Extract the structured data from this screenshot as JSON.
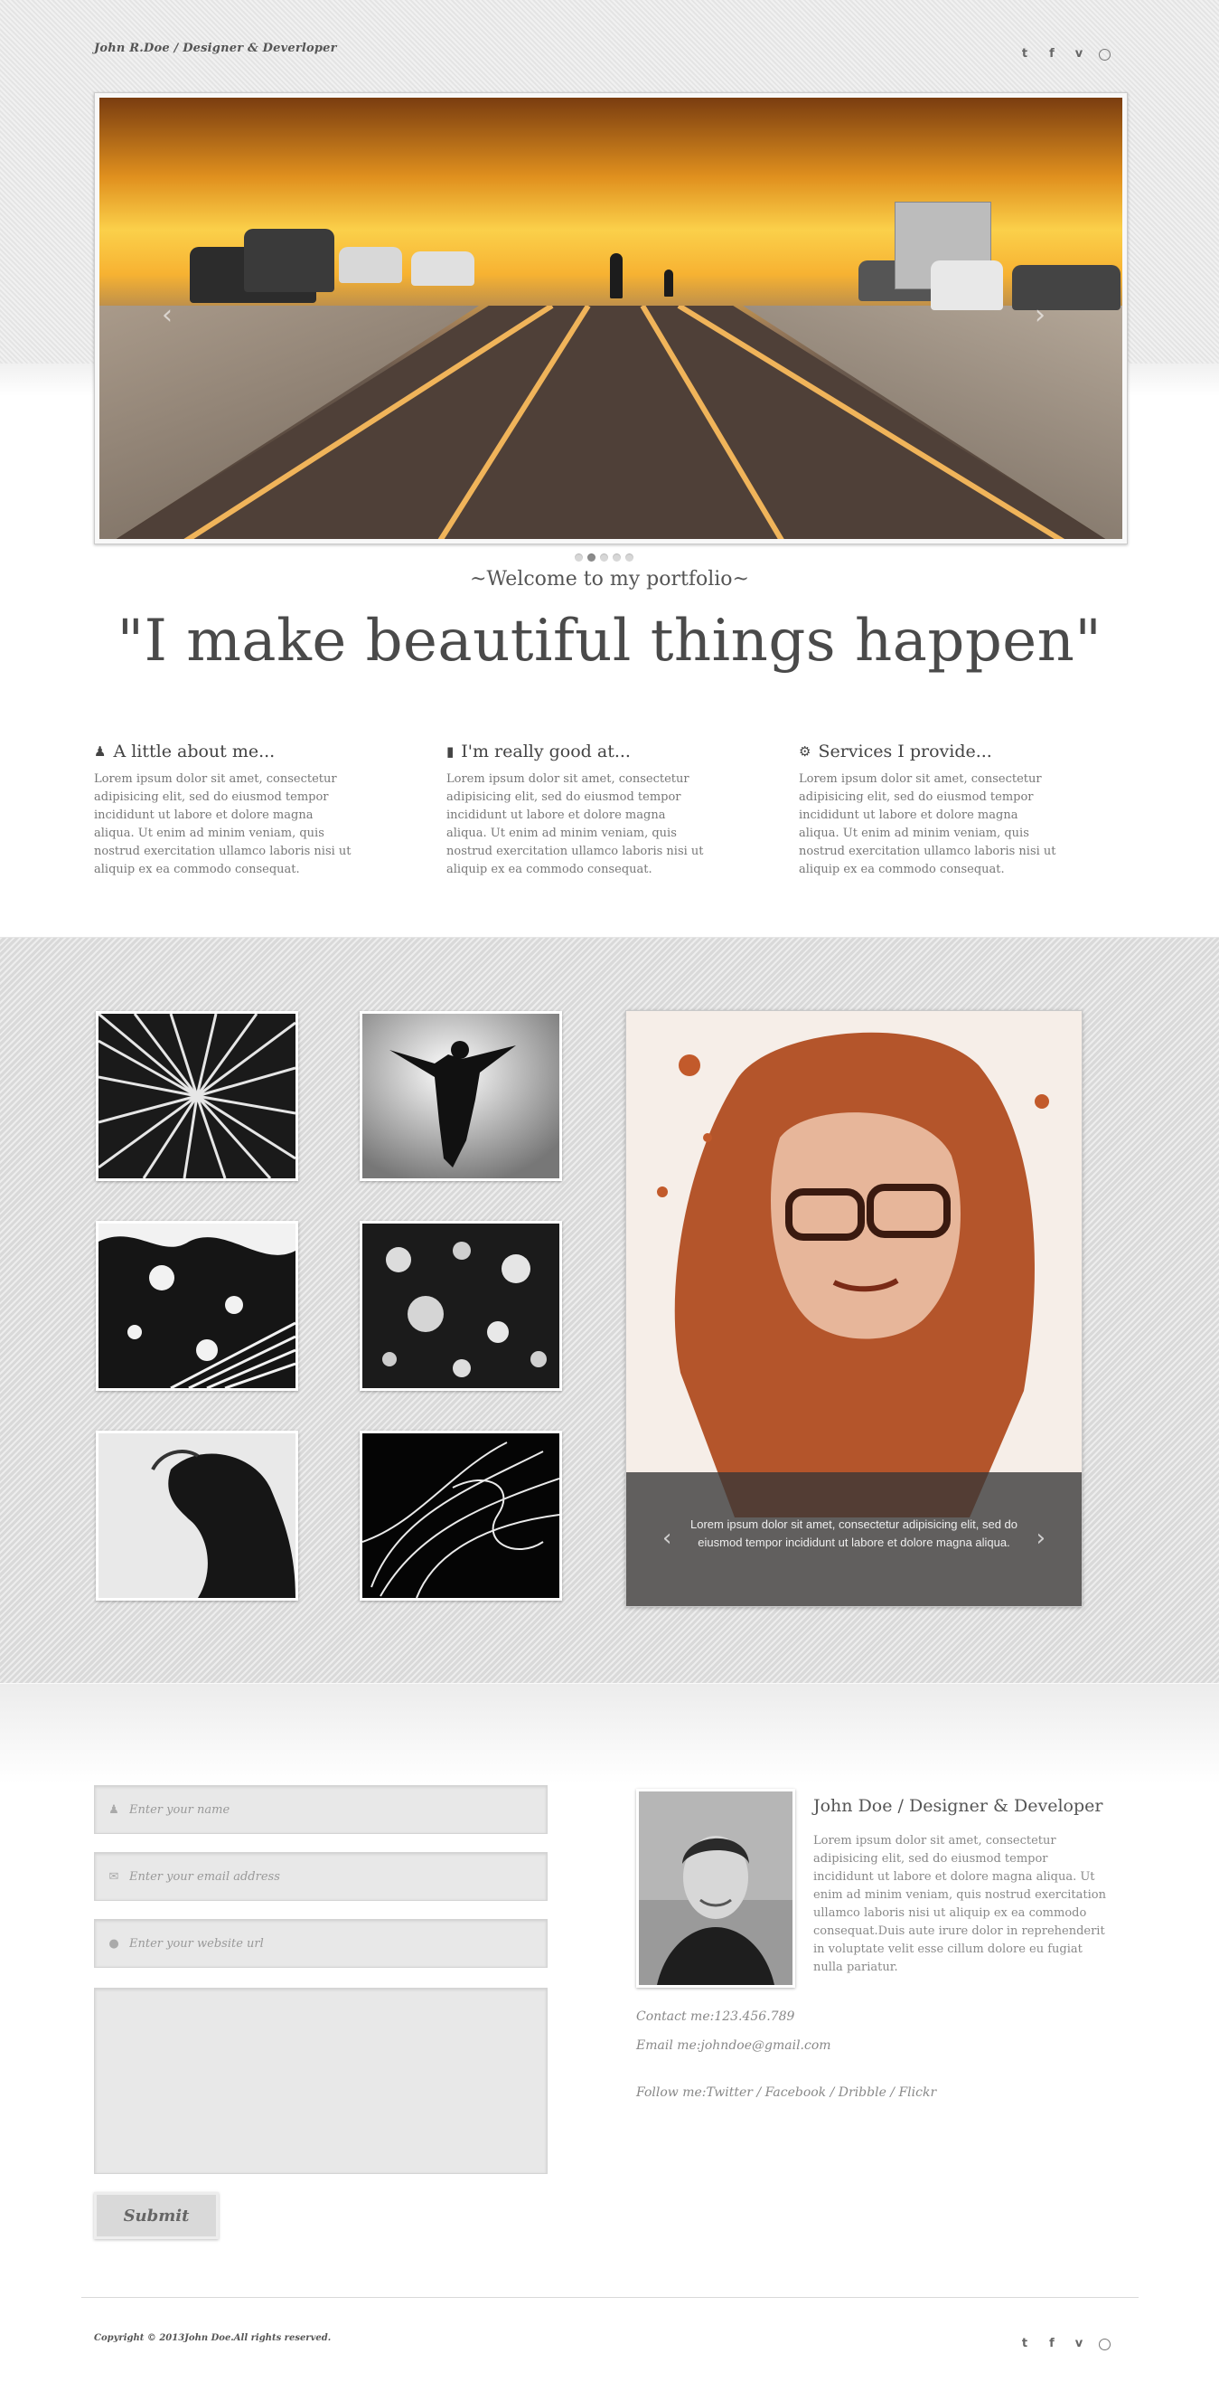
{
  "header": {
    "brand": "John R.Doe / Designer & Deverloper",
    "social": [
      {
        "name": "twitter",
        "glyph": "t"
      },
      {
        "name": "facebook",
        "glyph": "f"
      },
      {
        "name": "vimeo",
        "glyph": "v"
      },
      {
        "name": "dribbble",
        "glyph": "◎"
      }
    ]
  },
  "slider": {
    "prev_glyph": "‹",
    "next_glyph": "›",
    "dots_count": 5,
    "active_dot": 1
  },
  "intro": {
    "welcome": "~Welcome to my portfolio~",
    "tagline": "\"I make beautiful things happen\""
  },
  "columns": [
    {
      "icon": "user-icon",
      "glyph": "👤",
      "title": "A little about me...",
      "text": "Lorem ipsum dolor sit amet, consectetur adipisicing elit, sed do eiusmod tempor incididunt ut labore et dolore magna aliqua. Ut enim ad minim veniam, quis nostrud exercitation ullamco laboris nisi ut aliquip ex ea commodo consequat."
    },
    {
      "icon": "comment-icon",
      "glyph": "💬",
      "title": "I'm really good at...",
      "text": "Lorem ipsum dolor sit amet, consectetur adipisicing elit, sed do eiusmod tempor incididunt ut labore et dolore magna aliqua. Ut enim ad minim veniam, quis nostrud exercitation ullamco laboris nisi ut aliquip ex ea commodo consequat."
    },
    {
      "icon": "gear-icon",
      "glyph": "⚙",
      "title": "Services I provide...",
      "text": "Lorem ipsum dolor sit amet, consectetur adipisicing elit, sed do eiusmod tempor incididunt ut labore et dolore magna aliqua. Ut enim ad minim veniam, quis nostrud exercitation ullamco laboris nisi ut aliquip ex ea commodo consequat."
    }
  ],
  "gallery": {
    "caption": "Lorem ipsum dolor sit amet, consectetur adipisicing elit, sed do eiusmod tempor incididunt ut labore et dolore magna aliqua.",
    "prev_glyph": "‹",
    "next_glyph": "›"
  },
  "form": {
    "name_placeholder": "Enter your name",
    "email_placeholder": "Enter your email address",
    "website_placeholder": "Enter your website url",
    "submit_label": "Submit"
  },
  "profile": {
    "name": "John Doe / Designer & Developer",
    "bio": "Lorem ipsum dolor sit amet, consectetur adipisicing elit, sed do eiusmod tempor incididunt ut labore et dolore magna aliqua. Ut enim ad minim veniam, quis nostrud exercitation ullamco laboris nisi ut aliquip ex ea commodo consequat.Duis aute irure dolor in reprehenderit in voluptate velit esse cillum dolore eu fugiat nulla pariatur.",
    "contact": "Contact me:123.456.789",
    "email": "Email me:johndoe@gmail.com",
    "follow": "Follow me:Twitter / Facebook / Dribble / Flickr"
  },
  "footer": {
    "copyright": "Copyright © 2013John Doe.All rights reserved."
  }
}
